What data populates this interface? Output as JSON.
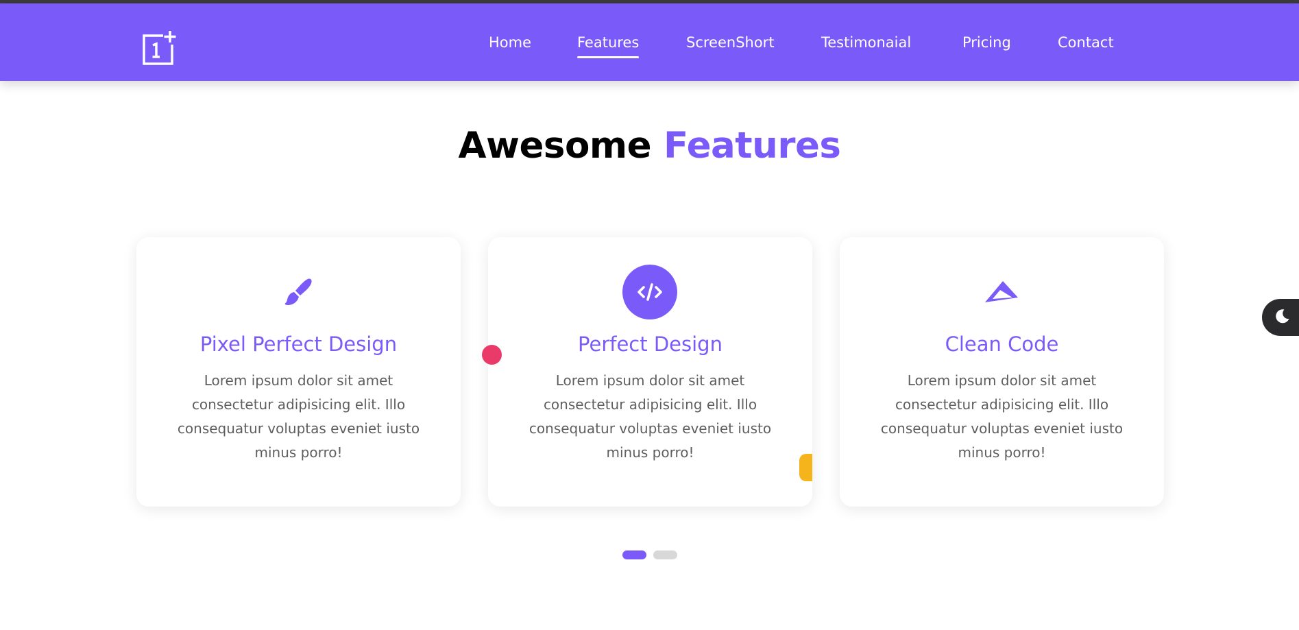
{
  "header": {
    "logo_icon": "oneplus-logo-icon",
    "nav": [
      {
        "label": "Home",
        "active": false
      },
      {
        "label": "Features",
        "active": true
      },
      {
        "label": "ScreenShort",
        "active": false
      },
      {
        "label": "Testimonaial",
        "active": false
      },
      {
        "label": "Pricing",
        "active": false
      },
      {
        "label": "Contact",
        "active": false
      }
    ]
  },
  "section": {
    "title_main": "Awesome",
    "title_accent": "Features"
  },
  "cards": [
    {
      "icon": "paint-brush-icon",
      "title": "Pixel Perfect Design",
      "text": "Lorem ipsum dolor sit amet consectetur adipisicing elit. Illo consequatur voluptas eveniet iusto minus porro!"
    },
    {
      "icon": "code-icon",
      "title": "Perfect Design",
      "text": "Lorem ipsum dolor sit amet consectetur adipisicing elit. Illo consequatur voluptas eveniet iusto minus porro!"
    },
    {
      "icon": "paper-plane-icon",
      "title": "Clean Code",
      "text": "Lorem ipsum dolor sit amet consectetur adipisicing elit. Illo consequatur voluptas eveniet iusto minus porro!"
    }
  ],
  "carousel": {
    "pages": 2,
    "active_page": 1
  },
  "theme_toggle": {
    "icon": "moon-icon"
  },
  "colors": {
    "primary": "#7a5af8",
    "pink_accent": "#ea3a6a",
    "yellow_accent": "#f5b31c",
    "dark": "#2b2b2e"
  }
}
